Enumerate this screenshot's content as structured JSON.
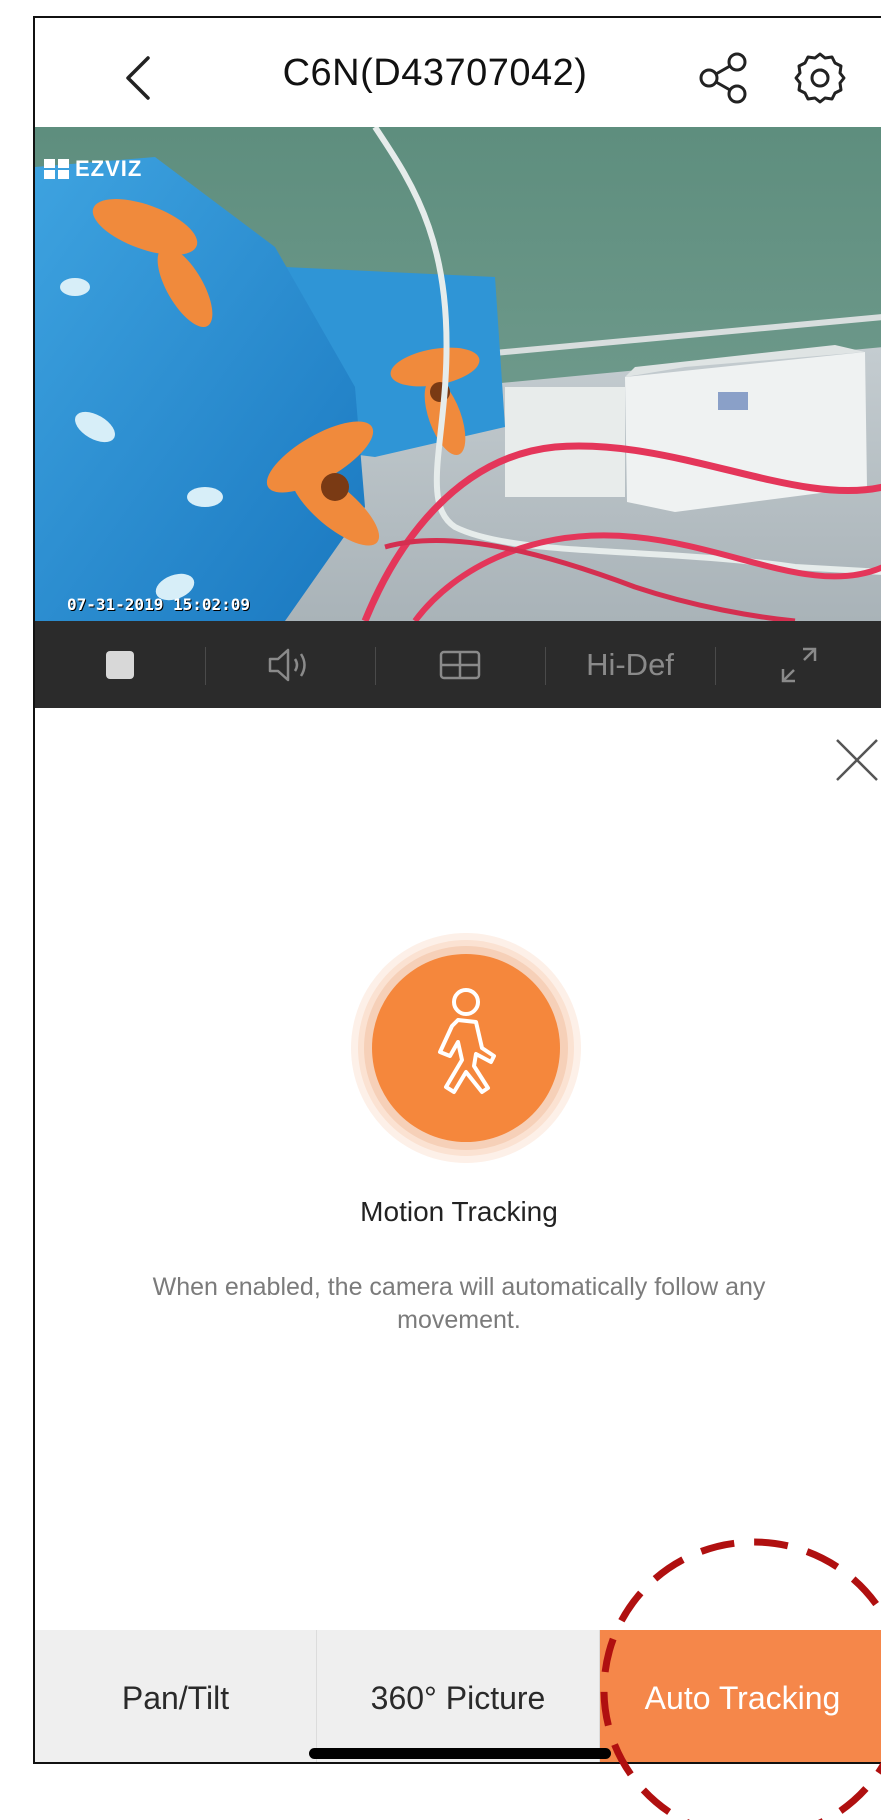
{
  "header": {
    "title": "C6N(D43707042)",
    "back_icon": "chevron-left-icon",
    "share_icon": "share-icon",
    "settings_icon": "gear-icon"
  },
  "video": {
    "logo_text": "EZVIZ",
    "timestamp": "07-31-2019 15:02:09"
  },
  "controls": {
    "stop_icon": "stop-icon",
    "sound_icon": "speaker-icon",
    "layout_icon": "grid-icon",
    "quality_label": "Hi-Def",
    "fullscreen_icon": "fullscreen-icon"
  },
  "panel": {
    "close_icon": "close-icon",
    "feature_icon": "walking-person-icon",
    "feature_title": "Motion Tracking",
    "feature_description": "When enabled, the camera will automatically follow any movement."
  },
  "tabs": [
    {
      "label": "Pan/Tilt",
      "active": false
    },
    {
      "label": "360° Picture",
      "active": false
    },
    {
      "label": "Auto Tracking",
      "active": true
    }
  ],
  "colors": {
    "accent": "#f5874a",
    "control_bar": "#2b2b2b",
    "tab_bg": "#efefef",
    "annotation": "#b01010"
  }
}
